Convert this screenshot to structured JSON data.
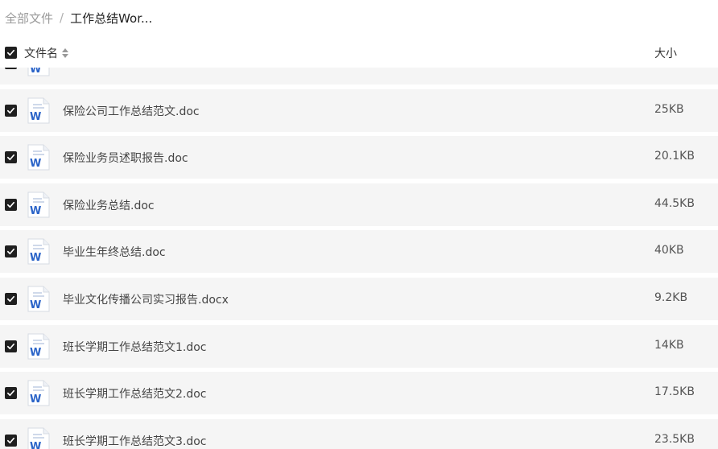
{
  "breadcrumb": {
    "root": "全部文件",
    "separator": "/",
    "current": "工作总结Wor..."
  },
  "header": {
    "name_label": "文件名",
    "size_label": "大小"
  },
  "files": [
    {
      "name": "",
      "size": "",
      "icon": "word-doc-icon",
      "checked": true
    },
    {
      "name": "保险公司工作总结范文.doc",
      "size": "25KB",
      "icon": "word-doc-icon",
      "checked": true
    },
    {
      "name": "保险业务员述职报告.doc",
      "size": "20.1KB",
      "icon": "word-doc-icon",
      "checked": true
    },
    {
      "name": "保险业务总结.doc",
      "size": "44.5KB",
      "icon": "word-doc-icon",
      "checked": true
    },
    {
      "name": "毕业生年终总结.doc",
      "size": "40KB",
      "icon": "word-doc-icon",
      "checked": true
    },
    {
      "name": "毕业文化传播公司实习报告.docx",
      "size": "9.2KB",
      "icon": "word-doc-icon",
      "checked": true
    },
    {
      "name": "班长学期工作总结范文1.doc",
      "size": "14KB",
      "icon": "word-doc-icon",
      "checked": true
    },
    {
      "name": "班长学期工作总结范文2.doc",
      "size": "17.5KB",
      "icon": "word-doc-icon",
      "checked": true
    },
    {
      "name": "班长学期工作总结范文3.doc",
      "size": "23.5KB",
      "icon": "word-doc-icon",
      "checked": true
    }
  ],
  "colors": {
    "row_bg": "#f5f5f5",
    "checkbox": "#1f1f1f",
    "word_blue": "#2b64c8"
  }
}
